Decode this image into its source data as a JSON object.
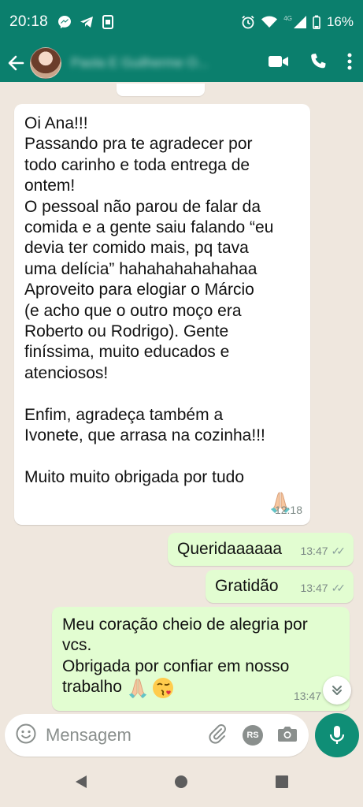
{
  "status_bar": {
    "time": "20:18",
    "network_tag": "4G",
    "battery": "16%",
    "left_icons": [
      "messenger-icon",
      "telegram-icon",
      "screenshot-icon"
    ],
    "right_icons": [
      "alarm-icon",
      "wifi-icon",
      "signal-icon",
      "battery-icon"
    ]
  },
  "header": {
    "contact_name": "Paola E Guilherme O...",
    "icons": [
      "back-arrow-icon",
      "video-call-icon",
      "phone-call-icon",
      "more-vert-icon"
    ]
  },
  "messages": [
    {
      "direction": "incoming",
      "text": "Oi Ana!!!\nPassando pra te agradecer por\ntodo carinho e toda entrega de\nontem!\nO pessoal não parou de falar da\ncomida e a gente saiu falando “eu\ndevia ter comido mais, pq tava\numa delícia” hahahahahahahaa\nAproveito para elogiar o Márcio\n(e acho que o outro moço era\nRoberto ou Rodrigo). Gente\nfiníssima, muito educados e\natenciosos!\n\nEnfim, agradeça também a\nIvonete, que arrasa na cozinha!!!\n\nMuito muito obrigada por tudo",
      "time": "12:18"
    },
    {
      "direction": "outgoing",
      "text": "Queridaaaaaa",
      "time": "13:47"
    },
    {
      "direction": "outgoing",
      "text": "Gratidão",
      "time": "13:47"
    },
    {
      "direction": "outgoing",
      "text": "Meu coração cheio de alegria por\nvcs.\nObrigada por confiar em nosso\ntrabalho",
      "time": "13:47"
    }
  ],
  "composer": {
    "placeholder": "Mensagem",
    "rs_badge": "RS"
  },
  "colors": {
    "header": "#0b7f6d",
    "chat_bg": "#efe7de",
    "incoming_bubble": "#ffffff",
    "outgoing_bubble": "#e2fdd1",
    "mic_button": "#0f8e76"
  }
}
